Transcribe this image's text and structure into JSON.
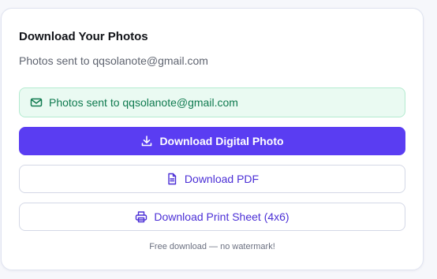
{
  "card": {
    "title": "Download Your Photos",
    "subtitle": "Photos sent to qqsolanote@gmail.com"
  },
  "notice": {
    "icon": "mail-icon",
    "text": "Photos sent to qqsolanote@gmail.com",
    "color": "#0f7a4f",
    "background": "#eafaf2"
  },
  "buttons": {
    "digital": {
      "label": "Download Digital Photo",
      "icon": "download-icon",
      "color": "#5a3df2"
    },
    "pdf": {
      "label": "Download PDF",
      "icon": "document-icon"
    },
    "print": {
      "label": "Download Print Sheet (4x6)",
      "icon": "printer-icon"
    }
  },
  "footnote": "Free download — no watermark!"
}
